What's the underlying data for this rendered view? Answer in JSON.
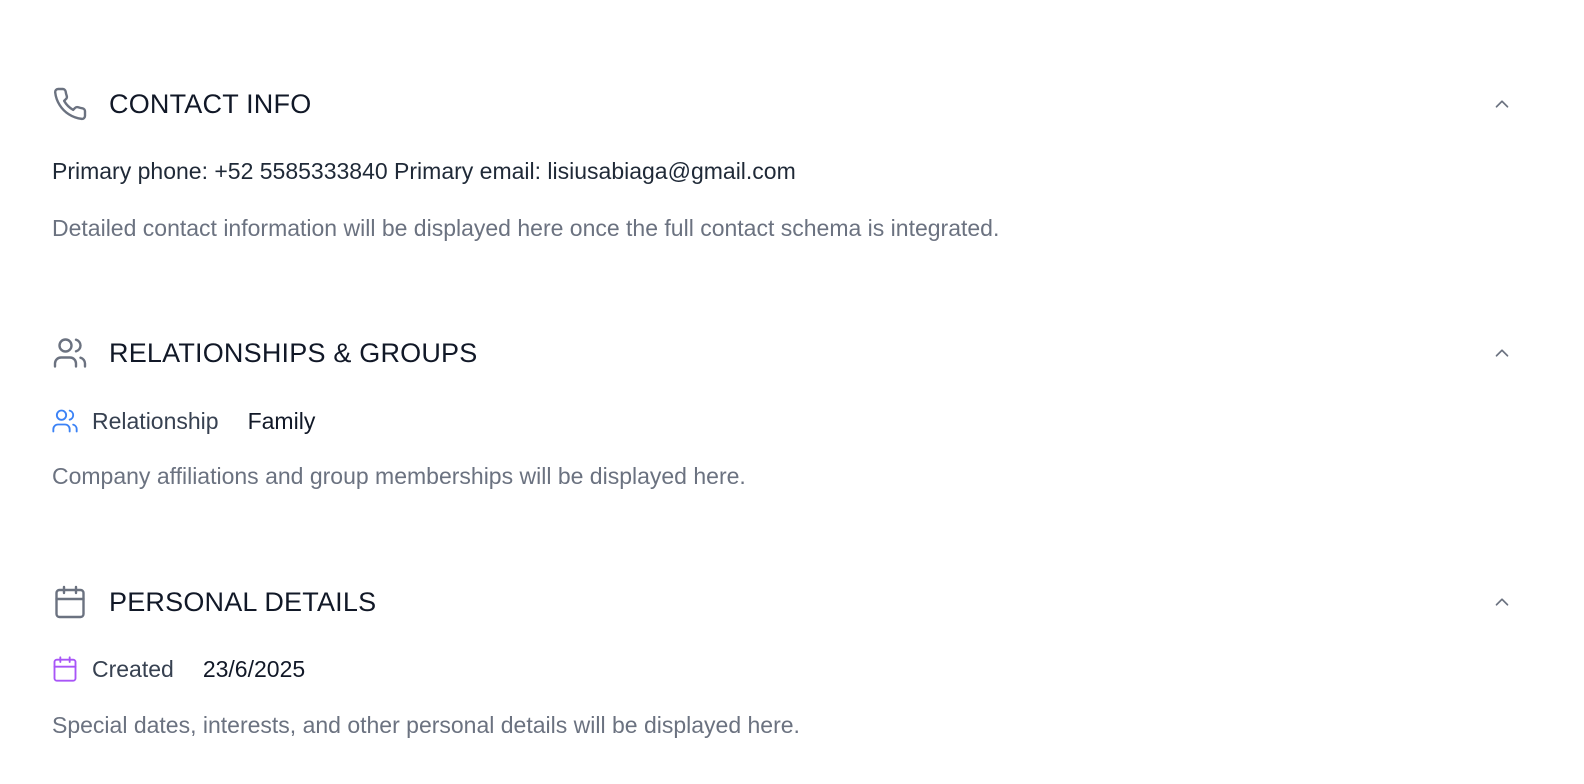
{
  "contact_info": {
    "title": "CONTACT INFO",
    "icon": "phone-icon",
    "summary": "Primary phone: +52 5585333840 Primary email: lisiusabiaga@gmail.com",
    "note": "Detailed contact information will be displayed here once the full contact schema is integrated.",
    "expanded": true
  },
  "relationships": {
    "title": "RELATIONSHIPS & GROUPS",
    "icon": "users-icon",
    "field": {
      "icon": "users-icon",
      "label": "Relationship",
      "value": "Family"
    },
    "note": "Company affiliations and group memberships will be displayed here.",
    "expanded": true
  },
  "personal_details": {
    "title": "PERSONAL DETAILS",
    "icon": "calendar-icon",
    "field": {
      "icon": "calendar-icon",
      "label": "Created",
      "value": "23/6/2025"
    },
    "note": "Special dates, interests, and other personal details will be displayed here.",
    "expanded": true
  },
  "colors": {
    "heading": "#111827",
    "text": "#1f2937",
    "muted": "#6b7280",
    "icon_gray": "#6b7280",
    "relationship_icon": "#3b82f6",
    "created_icon": "#a855f7"
  }
}
